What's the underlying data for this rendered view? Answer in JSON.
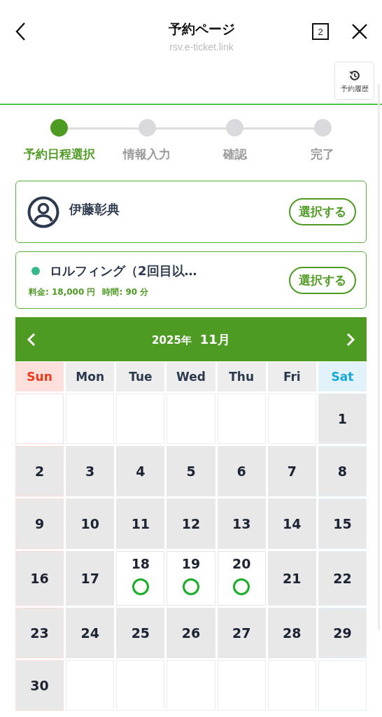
{
  "header": {
    "title": "予約ページ",
    "url": "rsv.e-ticket.link",
    "tab_count": "2"
  },
  "history_button": {
    "label": "予約履歴"
  },
  "steps": [
    {
      "label": "予約日程選択",
      "selected": true
    },
    {
      "label": "情報入力",
      "selected": false
    },
    {
      "label": "確認",
      "selected": false
    },
    {
      "label": "完了",
      "selected": false
    }
  ],
  "staff_card": {
    "name": "伊藤彰典",
    "button": "選択する"
  },
  "menu_card": {
    "name": "ロルフィング（2回目以…",
    "color": "#35b88a",
    "price": "料金: 18,000 円",
    "duration": "時間: 90 分",
    "button": "選択する"
  },
  "calendar": {
    "year": "2025年",
    "month": "11月",
    "weekdays": [
      {
        "label": "Sun",
        "kind": "sunday"
      },
      {
        "label": "Mon",
        "kind": "weekday"
      },
      {
        "label": "Tue",
        "kind": "weekday"
      },
      {
        "label": "Wed",
        "kind": "weekday"
      },
      {
        "label": "Thu",
        "kind": "weekday"
      },
      {
        "label": "Fri",
        "kind": "weekday"
      },
      {
        "label": "Sat",
        "kind": "saturday"
      }
    ],
    "weeks": [
      [
        {
          "kind": "blank"
        },
        {
          "kind": "blank"
        },
        {
          "kind": "blank"
        },
        {
          "kind": "blank"
        },
        {
          "kind": "blank"
        },
        {
          "kind": "blank"
        },
        {
          "kind": "day",
          "day": "1",
          "available": false
        }
      ],
      [
        {
          "kind": "day",
          "day": "2",
          "available": false
        },
        {
          "kind": "day",
          "day": "3",
          "available": false
        },
        {
          "kind": "day",
          "day": "4",
          "available": false
        },
        {
          "kind": "day",
          "day": "5",
          "available": false
        },
        {
          "kind": "day",
          "day": "6",
          "available": false
        },
        {
          "kind": "day",
          "day": "7",
          "available": false
        },
        {
          "kind": "day",
          "day": "8",
          "available": false
        }
      ],
      [
        {
          "kind": "day",
          "day": "9",
          "available": false
        },
        {
          "kind": "day",
          "day": "10",
          "available": false
        },
        {
          "kind": "day",
          "day": "11",
          "available": false
        },
        {
          "kind": "day",
          "day": "12",
          "available": false
        },
        {
          "kind": "day",
          "day": "13",
          "available": false
        },
        {
          "kind": "day",
          "day": "14",
          "available": false
        },
        {
          "kind": "day",
          "day": "15",
          "available": false
        }
      ],
      [
        {
          "kind": "day",
          "day": "16",
          "available": false
        },
        {
          "kind": "day",
          "day": "17",
          "available": false
        },
        {
          "kind": "day",
          "day": "18",
          "available": true
        },
        {
          "kind": "day",
          "day": "19",
          "available": true
        },
        {
          "kind": "day",
          "day": "20",
          "available": true
        },
        {
          "kind": "day",
          "day": "21",
          "available": false
        },
        {
          "kind": "day",
          "day": "22",
          "available": false
        }
      ],
      [
        {
          "kind": "day",
          "day": "23",
          "available": false
        },
        {
          "kind": "day",
          "day": "24",
          "available": false
        },
        {
          "kind": "day",
          "day": "25",
          "available": false
        },
        {
          "kind": "day",
          "day": "26",
          "available": false
        },
        {
          "kind": "day",
          "day": "27",
          "available": false
        },
        {
          "kind": "day",
          "day": "28",
          "available": false
        },
        {
          "kind": "day",
          "day": "29",
          "available": false
        }
      ],
      [
        {
          "kind": "day",
          "day": "30",
          "available": false
        },
        {
          "kind": "blank"
        },
        {
          "kind": "blank"
        },
        {
          "kind": "blank"
        },
        {
          "kind": "blank"
        },
        {
          "kind": "blank"
        },
        {
          "kind": "blank"
        }
      ]
    ]
  }
}
